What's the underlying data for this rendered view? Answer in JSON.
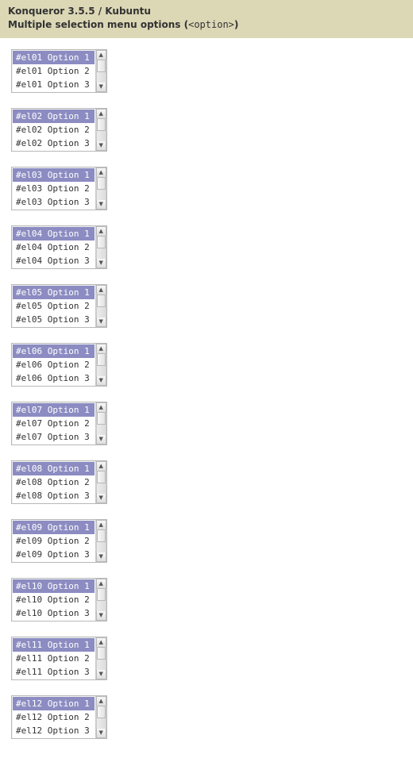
{
  "header": {
    "line1": "Konqueror 3.5.5 / Kubuntu",
    "line2_prefix": "Multiple selection menu options (",
    "line2_code": "<option>",
    "line2_suffix": ")"
  },
  "listCount": 12,
  "optionsPerList": 3,
  "selectedOptionIndex": 0,
  "colors": {
    "header_bg": "#dcd8b6",
    "selection_bg": "#8c8cc2",
    "selection_fg": "#ffffff"
  },
  "lists": [
    {
      "id": "el01",
      "options": [
        "#el01 Option 1",
        "#el01 Option 2",
        "#el01 Option 3"
      ]
    },
    {
      "id": "el02",
      "options": [
        "#el02 Option 1",
        "#el02 Option 2",
        "#el02 Option 3"
      ]
    },
    {
      "id": "el03",
      "options": [
        "#el03 Option 1",
        "#el03 Option 2",
        "#el03 Option 3"
      ]
    },
    {
      "id": "el04",
      "options": [
        "#el04 Option 1",
        "#el04 Option 2",
        "#el04 Option 3"
      ]
    },
    {
      "id": "el05",
      "options": [
        "#el05 Option 1",
        "#el05 Option 2",
        "#el05 Option 3"
      ]
    },
    {
      "id": "el06",
      "options": [
        "#el06 Option 1",
        "#el06 Option 2",
        "#el06 Option 3"
      ]
    },
    {
      "id": "el07",
      "options": [
        "#el07 Option 1",
        "#el07 Option 2",
        "#el07 Option 3"
      ]
    },
    {
      "id": "el08",
      "options": [
        "#el08 Option 1",
        "#el08 Option 2",
        "#el08 Option 3"
      ]
    },
    {
      "id": "el09",
      "options": [
        "#el09 Option 1",
        "#el09 Option 2",
        "#el09 Option 3"
      ]
    },
    {
      "id": "el10",
      "options": [
        "#el10 Option 1",
        "#el10 Option 2",
        "#el10 Option 3"
      ]
    },
    {
      "id": "el11",
      "options": [
        "#el11 Option 1",
        "#el11 Option 2",
        "#el11 Option 3"
      ]
    },
    {
      "id": "el12",
      "options": [
        "#el12 Option 1",
        "#el12 Option 2",
        "#el12 Option 3"
      ]
    }
  ],
  "scroll_arrows": {
    "up": "▲",
    "down": "▼"
  }
}
